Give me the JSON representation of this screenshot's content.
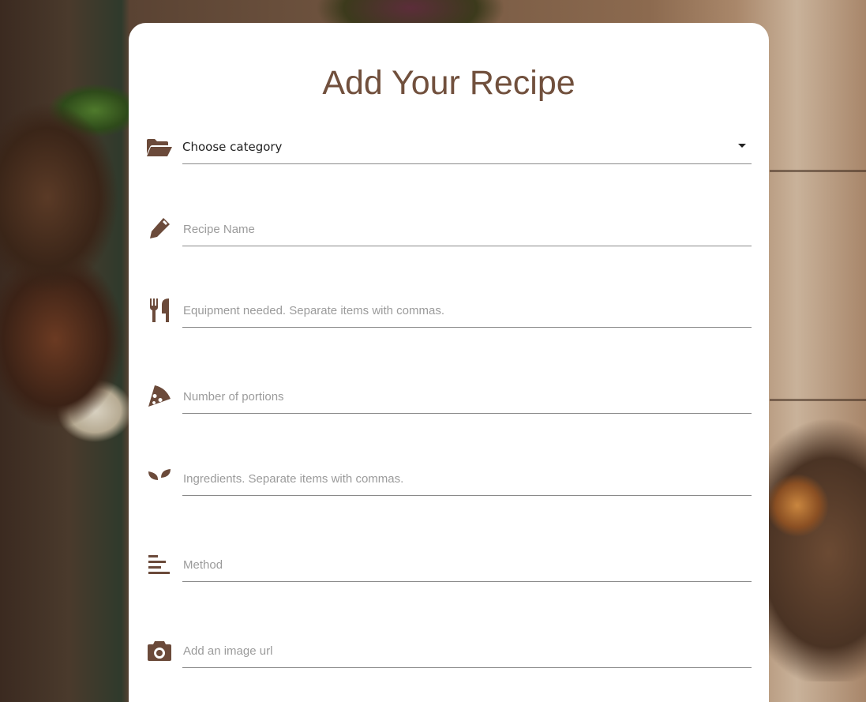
{
  "page": {
    "title": "Add Your Recipe"
  },
  "form": {
    "category": {
      "icon": "folder-open-icon",
      "selected": "Choose category"
    },
    "recipe_name": {
      "icon": "pencil-icon",
      "placeholder": "Recipe Name"
    },
    "equipment": {
      "icon": "utensils-icon",
      "placeholder": "Equipment needed. Separate items with commas."
    },
    "portions": {
      "icon": "pizza-slice-icon",
      "placeholder": "Number of portions"
    },
    "ingredients": {
      "icon": "seedling-icon",
      "placeholder": "Ingredients. Separate items with commas."
    },
    "method": {
      "icon": "align-left-icon",
      "placeholder": "Method"
    },
    "image_url": {
      "icon": "camera-icon",
      "placeholder": "Add an image url"
    }
  },
  "colors": {
    "accent": "#71503d",
    "icon": "#6b4a3a",
    "underline": "#8a8a8a",
    "placeholder": "#9b9b9b"
  }
}
